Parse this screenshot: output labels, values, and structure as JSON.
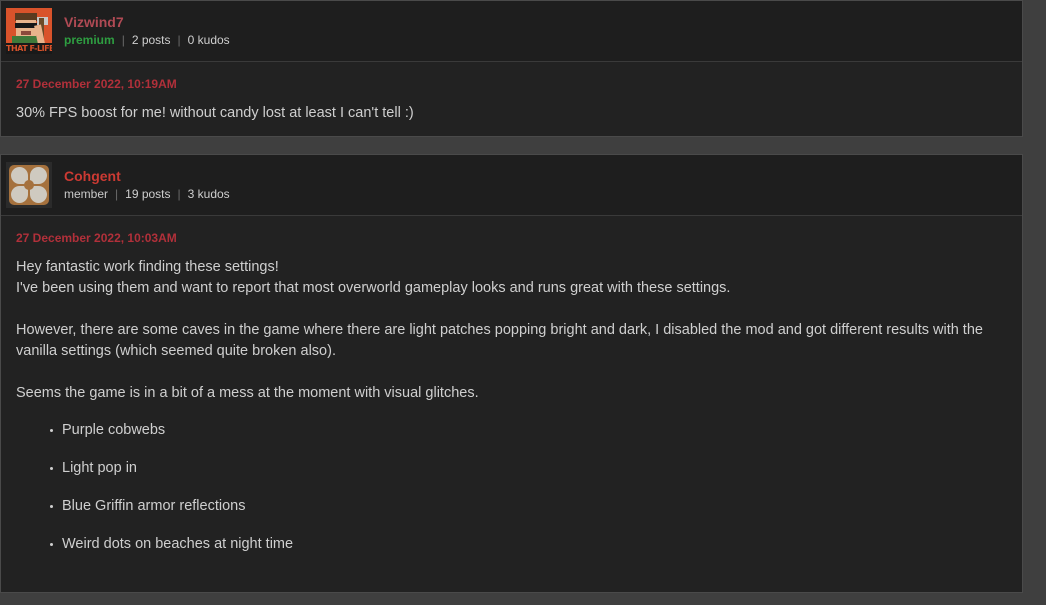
{
  "theme": {
    "page_background": "#3f3f3f",
    "card_background": "#222222",
    "header_background": "#1e1e1e",
    "card_border": "#4a4a4a",
    "body_text_color": "#cfcfcf",
    "timestamp_color": "#b1303a",
    "premium_color": "#2e9e41",
    "username_premium_color": "#b04a54",
    "username_member_color": "#cc3a33"
  },
  "posts": [
    {
      "avatar_icon": "pixel-art-lumberjack-avatar",
      "avatar_caption": "THAT F-LIFE",
      "username": "Vizwind7",
      "rank": "premium",
      "posts_count": "2 posts",
      "kudos_count": "0 kudos",
      "separator": "|",
      "timestamp": "27 December 2022, 10:19AM",
      "paragraphs": [
        "30% FPS boost for me! without candy lost at least I can't tell :)"
      ],
      "list_items": []
    },
    {
      "avatar_icon": "tan-pinwheel-avatar",
      "username": "Cohgent",
      "rank": "member",
      "posts_count": "19 posts",
      "kudos_count": "3 kudos",
      "separator": "|",
      "timestamp": "27 December 2022, 10:03AM",
      "paragraphs": [
        "Hey fantastic work finding these settings!",
        "I've been using them and want to report that most overworld gameplay looks and runs great with these settings.",
        "However, there are some caves in the game where there are light patches popping bright and dark, I disabled the mod and got different results with the vanilla settings (which seemed quite broken also).",
        "Seems the game is in a bit of a mess at the moment with visual glitches."
      ],
      "list_items": [
        "Purple cobwebs",
        "Light pop in",
        "Blue Griffin armor reflections",
        "Weird dots on beaches at night time"
      ]
    }
  ]
}
